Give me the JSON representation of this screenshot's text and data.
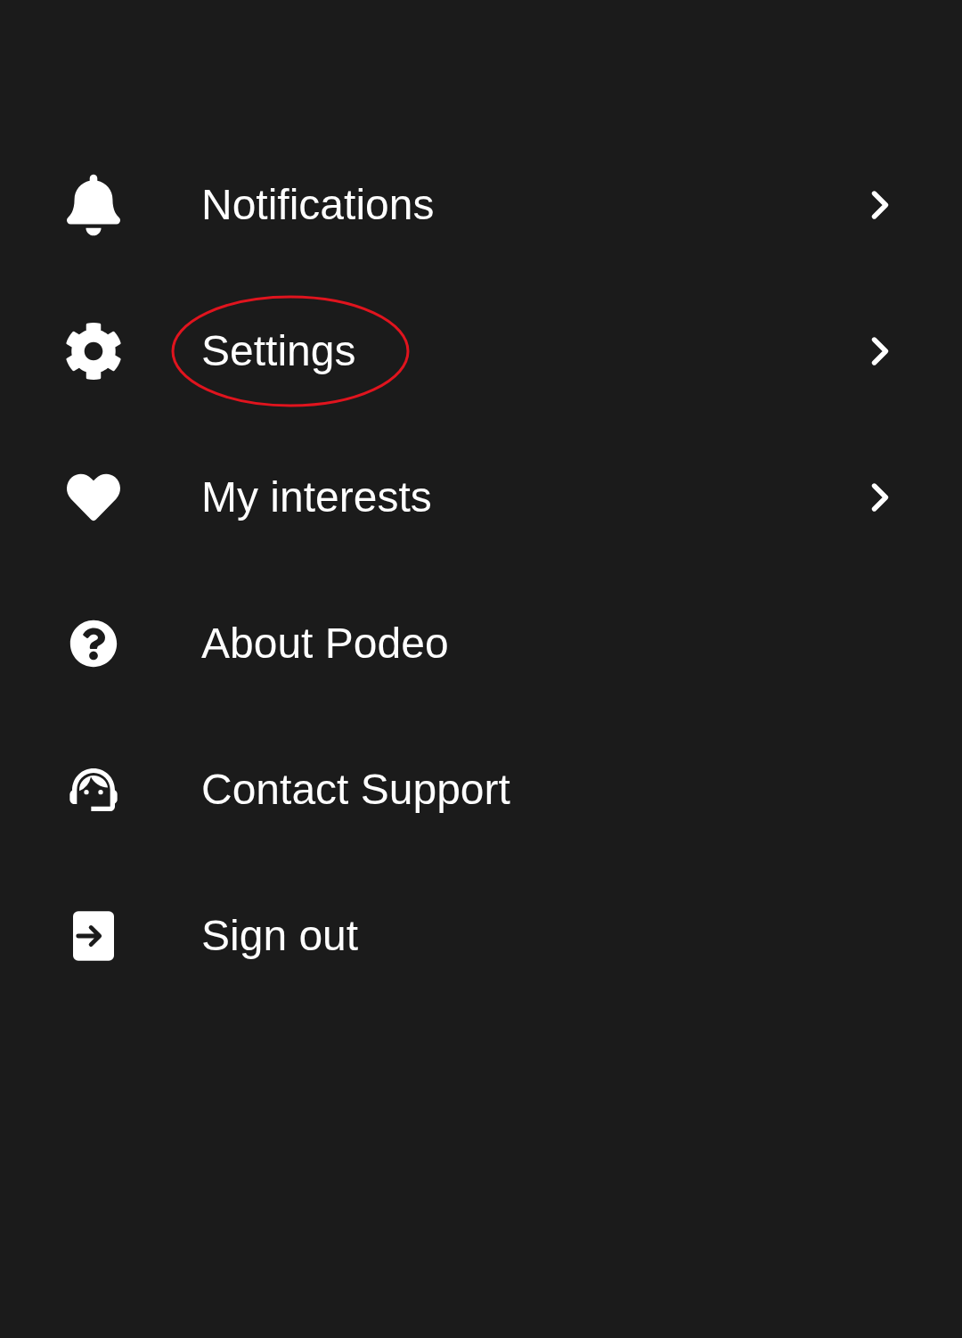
{
  "menu": {
    "items": [
      {
        "label": "Notifications",
        "has_arrow": true,
        "highlighted": false
      },
      {
        "label": "Settings",
        "has_arrow": true,
        "highlighted": true
      },
      {
        "label": "My interests",
        "has_arrow": true,
        "highlighted": false
      },
      {
        "label": "About Podeo",
        "has_arrow": false,
        "highlighted": false
      },
      {
        "label": "Contact Support",
        "has_arrow": false,
        "highlighted": false
      },
      {
        "label": "Sign out",
        "has_arrow": false,
        "highlighted": false
      }
    ]
  }
}
